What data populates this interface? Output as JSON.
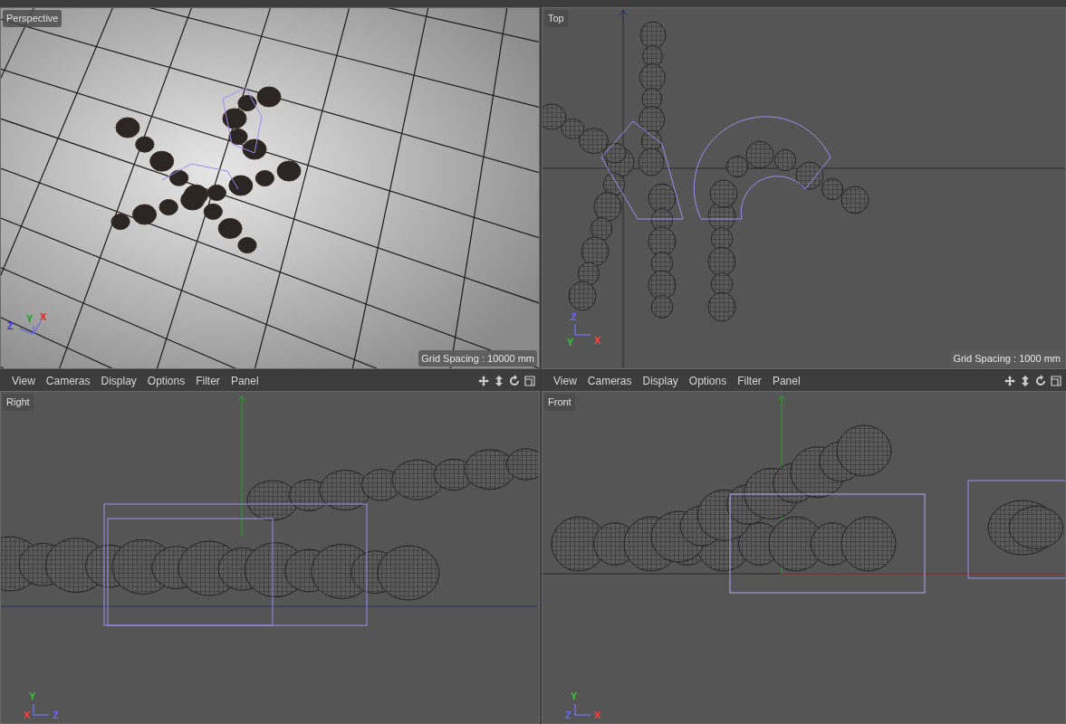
{
  "viewports": [
    {
      "kind": "perspective",
      "label": "Perspective",
      "grid_spacing": "Grid Spacing : 10000 mm",
      "axes": [
        {
          "label": "Z",
          "color": "#3030e0"
        },
        {
          "label": "Y",
          "color": "#10a010"
        },
        {
          "label": "X",
          "color": "#d82020"
        }
      ]
    },
    {
      "kind": "top",
      "label": "Top",
      "grid_spacing": "Grid Spacing : 1000 mm",
      "axes": [
        {
          "label": "Z",
          "color": "#6a6aff"
        },
        {
          "label": "Y",
          "color": "#33cc33"
        },
        {
          "label": "X",
          "color": "#ff4040"
        }
      ]
    },
    {
      "kind": "right",
      "label": "Right",
      "menu": [
        "View",
        "Cameras",
        "Display",
        "Options",
        "Filter",
        "Panel"
      ],
      "axes": [
        {
          "label": "Y",
          "color": "#33cc33"
        },
        {
          "label": "X",
          "color": "#ff4040"
        },
        {
          "label": "Z",
          "color": "#6a6aff"
        }
      ]
    },
    {
      "kind": "front",
      "label": "Front",
      "menu": [
        "View",
        "Cameras",
        "Display",
        "Options",
        "Filter",
        "Panel"
      ],
      "axes": [
        {
          "label": "Y",
          "color": "#33cc33"
        },
        {
          "label": "Z",
          "color": "#6a6aff"
        },
        {
          "label": "X",
          "color": "#ff4040"
        }
      ]
    }
  ]
}
